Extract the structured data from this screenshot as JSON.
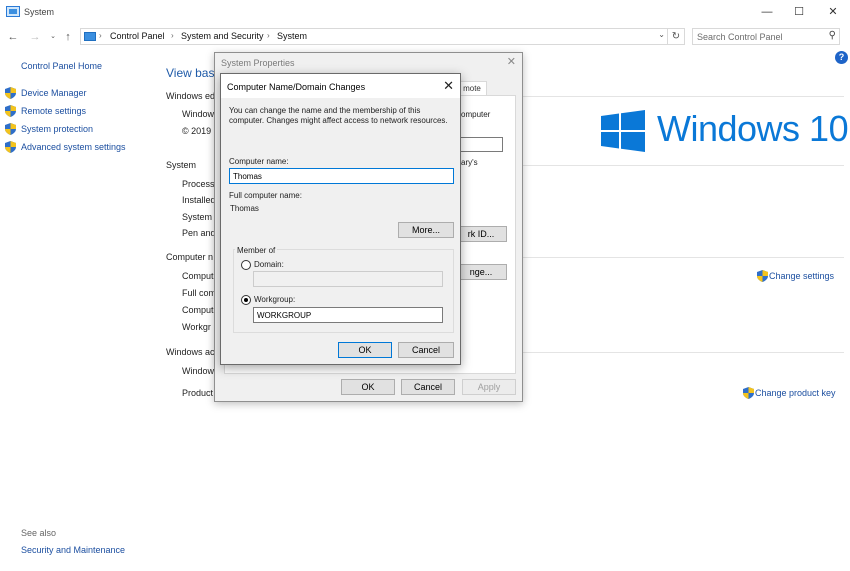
{
  "window": {
    "title": "System"
  },
  "address": {
    "crumbs": [
      "Control Panel",
      "System and Security",
      "System"
    ],
    "search_placeholder": "Search Control Panel"
  },
  "left_pane": {
    "home": "Control Panel Home",
    "items": [
      "Device Manager",
      "Remote settings",
      "System protection",
      "Advanced system settings"
    ],
    "see_also": "See also",
    "see_also_items": [
      "Security and Maintenance"
    ]
  },
  "main": {
    "heading": "View bas",
    "windows_edition": {
      "header": "Windows ed",
      "rows": [
        "Window",
        "© 2019 M"
      ]
    },
    "system": {
      "header": "System",
      "rows": [
        "Processo",
        "Installed",
        "System t",
        "Pen and"
      ]
    },
    "computer": {
      "header": "Computer n",
      "rows": [
        "Comput",
        "Full com",
        "Comput",
        "Workgr"
      ],
      "change_link": "Change settings"
    },
    "activation": {
      "header": "Windows ac",
      "rows": [
        "Window",
        "Product"
      ],
      "change_link": "Change product key"
    },
    "logo_text": "Windows 10"
  },
  "system_properties": {
    "title": "System Properties",
    "tab_visible": "mote",
    "text_lines": [
      "omputer",
      "ary's"
    ],
    "network_id_button": "rk ID...",
    "change_button": "nge...",
    "ok": "OK",
    "cancel": "Cancel",
    "apply": "Apply"
  },
  "computer_name_dialog": {
    "title": "Computer Name/Domain Changes",
    "description": "You can change the name and the membership of this computer. Changes might affect access to network resources.",
    "computer_name_label": "Computer name:",
    "computer_name_value": "Thomas",
    "full_name_label": "Full computer name:",
    "full_name_value": "Thomas",
    "more_button": "More...",
    "member_of": "Member of",
    "domain_label": "Domain:",
    "domain_value": "",
    "workgroup_label": "Workgroup:",
    "workgroup_value": "WORKGROUP",
    "selected": "workgroup",
    "ok": "OK",
    "cancel": "Cancel"
  },
  "colors": {
    "link": "#1c4fa0",
    "accent": "#0078d7",
    "logo": "#0a78d7"
  }
}
